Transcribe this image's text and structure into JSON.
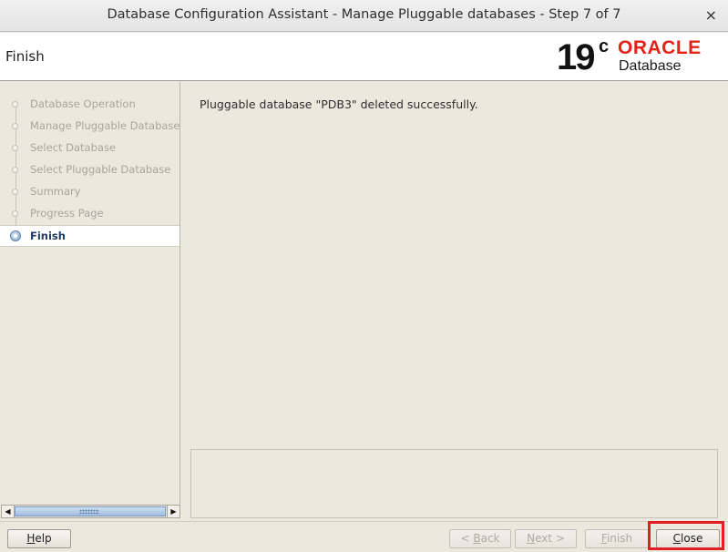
{
  "window": {
    "title": "Database Configuration Assistant - Manage Pluggable databases - Step 7 of 7",
    "close_glyph": "×"
  },
  "header": {
    "step_title": "Finish",
    "logo": {
      "version": "19",
      "version_sup": "c",
      "brand": "ORACLE",
      "product": "Database",
      "brand_color": "#e2231a"
    }
  },
  "nav": {
    "items": [
      {
        "label": "Database Operation",
        "state": "done"
      },
      {
        "label": "Manage Pluggable Databases",
        "state": "done"
      },
      {
        "label": "Select Database",
        "state": "done"
      },
      {
        "label": "Select Pluggable Database",
        "state": "done"
      },
      {
        "label": "Summary",
        "state": "done"
      },
      {
        "label": "Progress Page",
        "state": "done"
      },
      {
        "label": "Finish",
        "state": "active"
      }
    ]
  },
  "scrollbar": {
    "left_arrow": "◀",
    "right_arrow": "▶"
  },
  "main": {
    "message": "Pluggable database \"PDB3\" deleted successfully."
  },
  "buttons": {
    "help": {
      "mnemonic": "H",
      "rest": "elp"
    },
    "back": {
      "prefix": "< ",
      "mnemonic": "B",
      "rest": "ack"
    },
    "next": {
      "mnemonic": "N",
      "rest": "ext >"
    },
    "finish": {
      "mnemonic": "F",
      "rest": "inish"
    },
    "close": {
      "mnemonic": "C",
      "rest": "lose"
    }
  },
  "colors": {
    "highlight": "#e01f26",
    "active_step_text": "#1f3a63"
  }
}
